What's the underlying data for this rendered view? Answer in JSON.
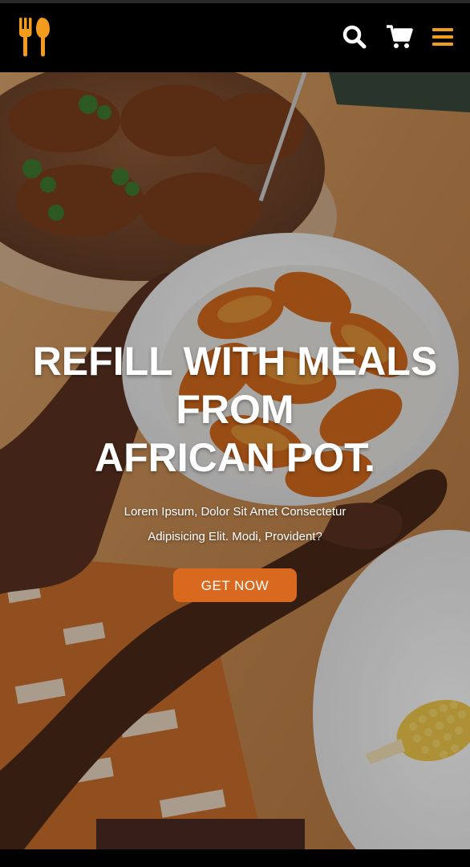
{
  "theme": {
    "accent": "#f29b1d",
    "button": "#d8691f",
    "navbar_bg": "#000000",
    "text": "#ffffff"
  },
  "navbar": {
    "logo_icon": "fork-spoon-icon",
    "icons": [
      "search-icon",
      "cart-icon",
      "hamburger-menu-icon"
    ]
  },
  "hero": {
    "title_lines": [
      "REFILL WITH MEALS",
      "FROM",
      "AFRICAN POT."
    ],
    "subtitle_lines": [
      "Lorem Ipsum, Dolor Sit Amet Consectetur",
      "Adipisicing Elit. Modi, Provident?"
    ],
    "cta_label": "GET NOW"
  }
}
